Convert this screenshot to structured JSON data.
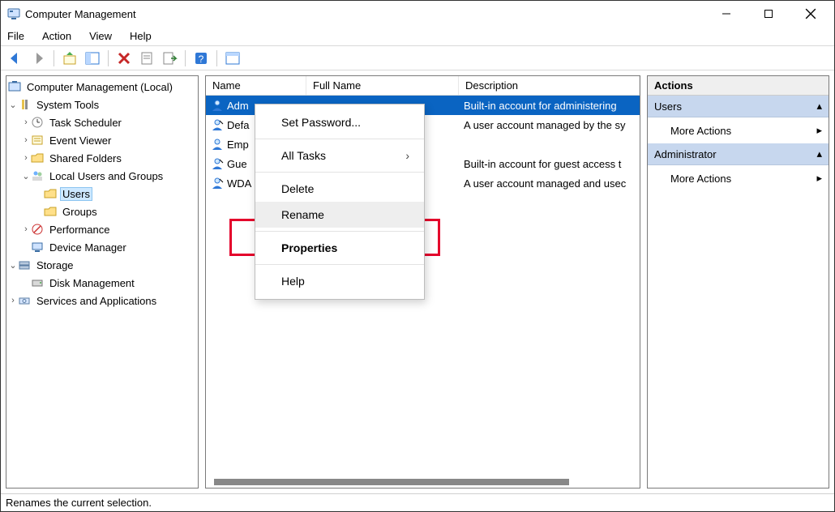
{
  "window": {
    "title": "Computer Management"
  },
  "menubar": {
    "file": "File",
    "action": "Action",
    "view": "View",
    "help": "Help"
  },
  "tree": {
    "root": "Computer Management (Local)",
    "system_tools": "System Tools",
    "task_scheduler": "Task Scheduler",
    "event_viewer": "Event Viewer",
    "shared_folders": "Shared Folders",
    "local_users": "Local Users and Groups",
    "users": "Users",
    "groups": "Groups",
    "performance": "Performance",
    "device_manager": "Device Manager",
    "storage": "Storage",
    "disk_management": "Disk Management",
    "services_apps": "Services and Applications"
  },
  "list": {
    "columns": {
      "name": "Name",
      "full_name": "Full Name",
      "description": "Description"
    },
    "rows": [
      {
        "name": "Adm",
        "full": "",
        "desc": "Built-in account for administering"
      },
      {
        "name": "Defa",
        "full": "",
        "desc": "A user account managed by the sy"
      },
      {
        "name": "Emp",
        "full": "",
        "desc": ""
      },
      {
        "name": "Gue",
        "full": "",
        "desc": "Built-in account for guest access t"
      },
      {
        "name": "WDA",
        "full": "",
        "desc": "A user account managed and usec"
      }
    ]
  },
  "context_menu": {
    "set_password": "Set Password...",
    "all_tasks": "All Tasks",
    "delete": "Delete",
    "rename": "Rename",
    "properties": "Properties",
    "help": "Help"
  },
  "actions": {
    "title": "Actions",
    "users": "Users",
    "more_actions": "More Actions",
    "administrator": "Administrator"
  },
  "status": "Renames the current selection."
}
